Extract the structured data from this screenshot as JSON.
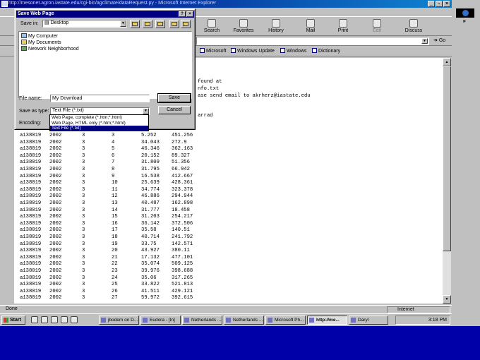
{
  "window": {
    "title": "http://mesonet.agron.iastate.edu/cgi-bin/agclimate/dataRequest.py - Microsoft Internet Explorer",
    "buttons": [
      "_",
      "×"
    ]
  },
  "toolbar": {
    "buttons": [
      {
        "label": "Search",
        "icon": "search-icon"
      },
      {
        "label": "Favorites",
        "icon": "favorites-icon"
      },
      {
        "label": "History",
        "icon": "history-icon"
      },
      {
        "label": "Mail",
        "icon": "mail-icon"
      },
      {
        "label": "Print",
        "icon": "print-icon"
      },
      {
        "label": "Edit",
        "icon": "edit-icon",
        "disabled": true
      },
      {
        "label": "Discuss",
        "icon": "discuss-icon"
      }
    ],
    "chevron": "»"
  },
  "address": {
    "go_label": "Go"
  },
  "links": [
    "Microsoft",
    "Windows Update",
    "Windows",
    "Dictionary"
  ],
  "content": {
    "header_lines": [
      "found at",
      "nfo.txt",
      "ase send email to akrherz@iastate.edu",
      "",
      "arrad"
    ],
    "rows": [
      [
        "a138019",
        "2002",
        "3",
        "3",
        "5.252",
        "451.256"
      ],
      [
        "a138019",
        "2002",
        "3",
        "4",
        "34.043",
        "272.9"
      ],
      [
        "a138019",
        "2002",
        "3",
        "5",
        "46.346",
        "362.163"
      ],
      [
        "a138019",
        "2002",
        "3",
        "6",
        "20.152",
        "89.327"
      ],
      [
        "a138019",
        "2002",
        "3",
        "7",
        "31.809",
        "51.356"
      ],
      [
        "a138019",
        "2002",
        "3",
        "8",
        "31.795",
        "66.942"
      ],
      [
        "a138019",
        "2002",
        "3",
        "9",
        "16.538",
        "412.667"
      ],
      [
        "a138019",
        "2002",
        "3",
        "10",
        "25.639",
        "428.361"
      ],
      [
        "a138019",
        "2002",
        "3",
        "11",
        "34.774",
        "323.378"
      ],
      [
        "a138019",
        "2002",
        "3",
        "12",
        "46.886",
        "294.944"
      ],
      [
        "a138019",
        "2002",
        "3",
        "13",
        "40.487",
        "162.898"
      ],
      [
        "a138019",
        "2002",
        "3",
        "14",
        "31.777",
        "18.458"
      ],
      [
        "a138019",
        "2002",
        "3",
        "15",
        "31.203",
        "254.217"
      ],
      [
        "a138019",
        "2002",
        "3",
        "16",
        "36.142",
        "372.506"
      ],
      [
        "a138019",
        "2002",
        "3",
        "17",
        "35.58",
        "140.51"
      ],
      [
        "a138019",
        "2002",
        "3",
        "18",
        "40.714",
        "241.792"
      ],
      [
        "a138019",
        "2002",
        "3",
        "19",
        "33.75",
        "142.571"
      ],
      [
        "a138019",
        "2002",
        "3",
        "20",
        "43.927",
        "380.11"
      ],
      [
        "a138019",
        "2002",
        "3",
        "21",
        "17.132",
        "477.101"
      ],
      [
        "a138019",
        "2002",
        "3",
        "22",
        "35.074",
        "509.125"
      ],
      [
        "a138019",
        "2002",
        "3",
        "23",
        "39.976",
        "398.688"
      ],
      [
        "a138019",
        "2002",
        "3",
        "24",
        "35.06",
        "317.265"
      ],
      [
        "a138019",
        "2002",
        "3",
        "25",
        "33.822",
        "521.813"
      ],
      [
        "a138019",
        "2002",
        "3",
        "26",
        "41.511",
        "429.121"
      ],
      [
        "a138019",
        "2002",
        "3",
        "27",
        "59.972",
        "392.615"
      ]
    ]
  },
  "status": {
    "text": "Done",
    "zone": "Internet"
  },
  "taskbar": {
    "start": "Start",
    "tasks": [
      {
        "label": "jbodem on D...",
        "active": false
      },
      {
        "label": "Eudora - [In]",
        "active": false
      },
      {
        "label": "Netherlands ...",
        "active": false
      },
      {
        "label": "Netherlands ...",
        "active": false
      },
      {
        "label": "Microsoft Ph...",
        "active": false
      },
      {
        "label": "http://me...",
        "active": true
      },
      {
        "label": "Daryl",
        "active": false
      }
    ],
    "clock": "3:18 PM"
  },
  "dialog": {
    "title": "Save Web Page",
    "title_buttons": [
      "?",
      "×"
    ],
    "save_in_label": "Save in:",
    "save_in_value": "Desktop",
    "items": [
      "My Computer",
      "My Documents",
      "Network Neighborhood"
    ],
    "filename_label": "File name:",
    "filename_value": "My Download",
    "savetype_label": "Save as type:",
    "savetype_value": "Text File (*.txt)",
    "encoding_label": "Encoding:",
    "save_button": "Save",
    "cancel_button": "Cancel",
    "type_options": [
      {
        "label": "Web Page, complete (*.htm;*.html)",
        "selected": false
      },
      {
        "label": "Web Page, HTML only (*.htm;*.html)",
        "selected": false
      },
      {
        "label": "Text File (*.txt)",
        "selected": true
      }
    ]
  },
  "colors": {
    "desktop": "#0000a8",
    "titlebar": "#000080",
    "selection": "#000080"
  }
}
